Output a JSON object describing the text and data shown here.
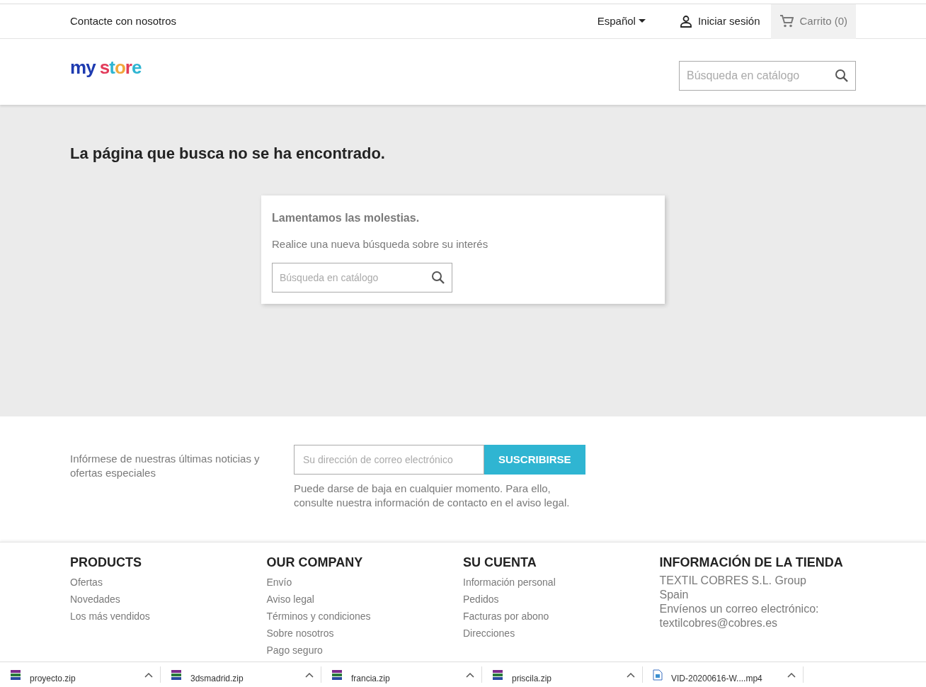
{
  "top_nav": {
    "contact": "Contacte con nosotros",
    "language": "Español",
    "sign_in": "Iniciar sesión",
    "cart": "Carrito (0)"
  },
  "header": {
    "logo": "my store",
    "search": {
      "placeholder": "Búsqueda en catálogo"
    }
  },
  "main": {
    "title": "La página que busca no se ha encontrado.",
    "card": {
      "heading": "Lamentamos las molestias.",
      "text": "Realice una nueva búsqueda sobre su interés",
      "search": {
        "placeholder": "Búsqueda en catálogo"
      }
    }
  },
  "newsletter": {
    "text": "Infórmese de nuestras últimas noticias y ofertas especiales",
    "email": {
      "placeholder": "Su dirección de correo electrónico"
    },
    "button": "SUSCRIBIRSE",
    "note": "Puede darse de baja en cualquier momento. Para ello, consulte nuestra información de contacto en el aviso legal."
  },
  "footer": {
    "columns": [
      {
        "title": "PRODUCTS",
        "links": [
          "Ofertas",
          "Novedades",
          "Los más vendidos"
        ]
      },
      {
        "title": "OUR COMPANY",
        "links": [
          "Envío",
          "Aviso legal",
          "Términos y condiciones",
          "Sobre nosotros",
          "Pago seguro"
        ]
      },
      {
        "title": "SU CUENTA",
        "links": [
          "Información personal",
          "Pedidos",
          "Facturas por abono",
          "Direcciones"
        ]
      },
      {
        "title": "INFORMACIÓN DE LA TIENDA",
        "lines": [
          "TEXTIL COBRES S.L. Group",
          "Spain",
          "Envíenos un correo electrónico:",
          "textilcobres@cobres.es"
        ]
      }
    ]
  },
  "downloads": [
    {
      "name": "proyecto.zip",
      "kind": "archive"
    },
    {
      "name": "3dsmadrid.zip",
      "kind": "archive"
    },
    {
      "name": "francia.zip",
      "kind": "archive"
    },
    {
      "name": "priscila.zip",
      "kind": "archive"
    },
    {
      "name": "VID-20200616-W....mp4",
      "kind": "video"
    }
  ]
}
